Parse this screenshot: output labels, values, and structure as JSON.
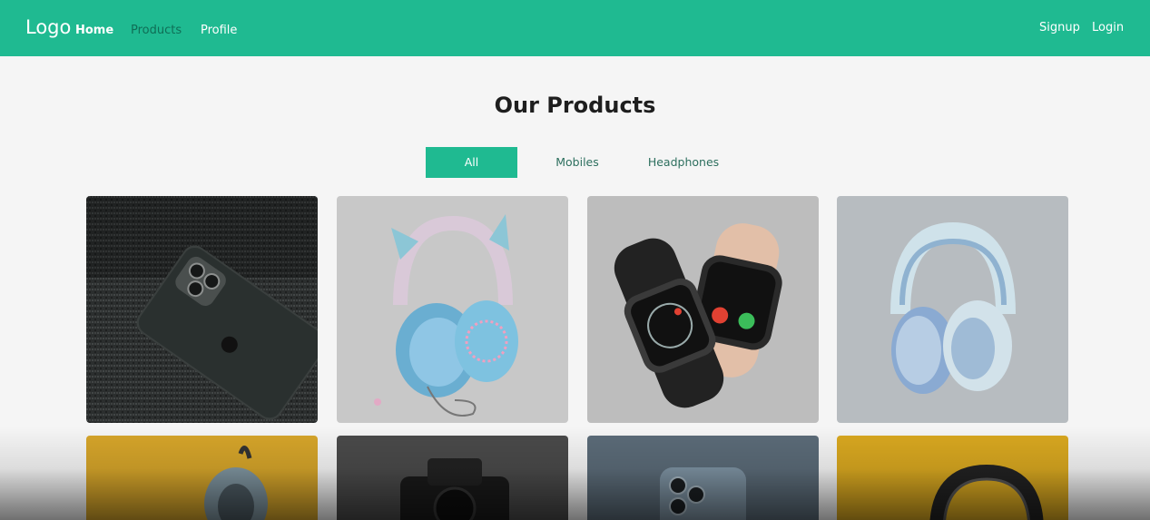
{
  "nav": {
    "logo": "Logo",
    "links": [
      "Home",
      "Products",
      "Profile"
    ],
    "auth": [
      "Signup",
      "Login"
    ]
  },
  "page": {
    "title": "Our Products"
  },
  "filters": [
    {
      "label": "All",
      "active": true
    },
    {
      "label": "Mobiles",
      "active": false
    },
    {
      "label": "Headphones",
      "active": false
    }
  ],
  "products": [
    {
      "kind": "phone",
      "image": "black smartphone on dark textured surface"
    },
    {
      "kind": "headphones",
      "image": "pink and blue cat-ear headphones"
    },
    {
      "kind": "watch",
      "image": "two smartwatches"
    },
    {
      "kind": "headphones",
      "image": "light blue headphones"
    },
    {
      "kind": "headphones",
      "image": "headphones on yellow background"
    },
    {
      "kind": "camera",
      "image": "black camera on dark background"
    },
    {
      "kind": "phone",
      "image": "blue smartphone camera closeup"
    },
    {
      "kind": "headphones",
      "image": "black headphones on yellow background"
    }
  ],
  "colors": {
    "brand": "#1fba91",
    "background": "#f5f5f5",
    "title": "#1e1e1e"
  }
}
